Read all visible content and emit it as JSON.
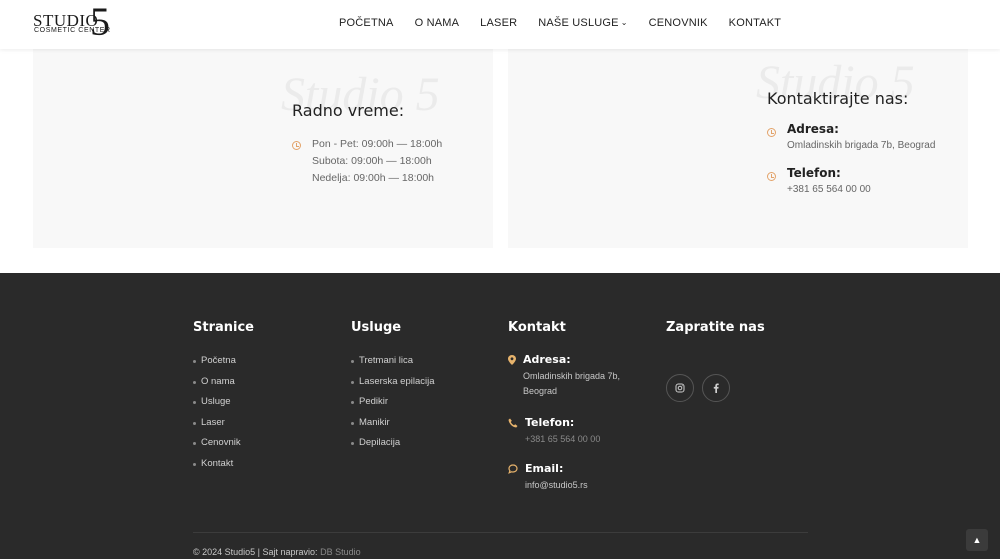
{
  "logo": {
    "word": "STUDIO",
    "number": "5",
    "subtitle": "COSMETIC CENTER"
  },
  "nav": {
    "items": [
      "POČETNA",
      "O NAMA",
      "LASER",
      "NAŠE USLUGE",
      "CENOVNIK",
      "KONTAKT"
    ]
  },
  "hours_card": {
    "watermark": "Studio 5",
    "title": "Radno vreme:",
    "lines": [
      "Pon - Pet: 09:00h — 18:00h",
      "Subota: 09:00h — 18:00h",
      "Nedelja: 09:00h — 18:00h"
    ]
  },
  "contact_card": {
    "watermark": "Studio 5",
    "title": "Kontaktirajte nas:",
    "address_label": "Adresa:",
    "address_value": "Omladinskih brigada 7b, Beograd",
    "phone_label": "Telefon:",
    "phone_value": "+381 65 564 00 00"
  },
  "footer": {
    "pages": {
      "title": "Stranice",
      "items": [
        "Početna",
        "O nama",
        "Usluge",
        "Laser",
        "Cenovnik",
        "Kontakt"
      ]
    },
    "services": {
      "title": "Usluge",
      "items": [
        "Tretmani lica",
        "Laserska epilacija",
        "Pedikir",
        "Manikir",
        "Depilacija"
      ]
    },
    "contact": {
      "title": "Kontakt",
      "address_label": "Adresa:",
      "address_line1": "Omladinskih brigada 7b,",
      "address_line2": "Beograd",
      "phone_label": "Telefon:",
      "phone_value": "+381 65 564 00 00",
      "email_label": "Email:",
      "email_value": "info@studio5.rs"
    },
    "follow": {
      "title": "Zapratite nas"
    },
    "copyright": "© 2024 Studio5 | Sajt napravio:",
    "credit": "DB Studio"
  },
  "colors": {
    "accent": "#e3a36a",
    "footer_bg": "#2a2a2a",
    "card_bg": "#f8f8f8"
  },
  "icons": [
    "clock-icon",
    "location-pin-icon",
    "phone-icon",
    "chat-icon",
    "instagram-icon",
    "facebook-icon",
    "arrow-up-icon",
    "chevron-down-icon"
  ]
}
